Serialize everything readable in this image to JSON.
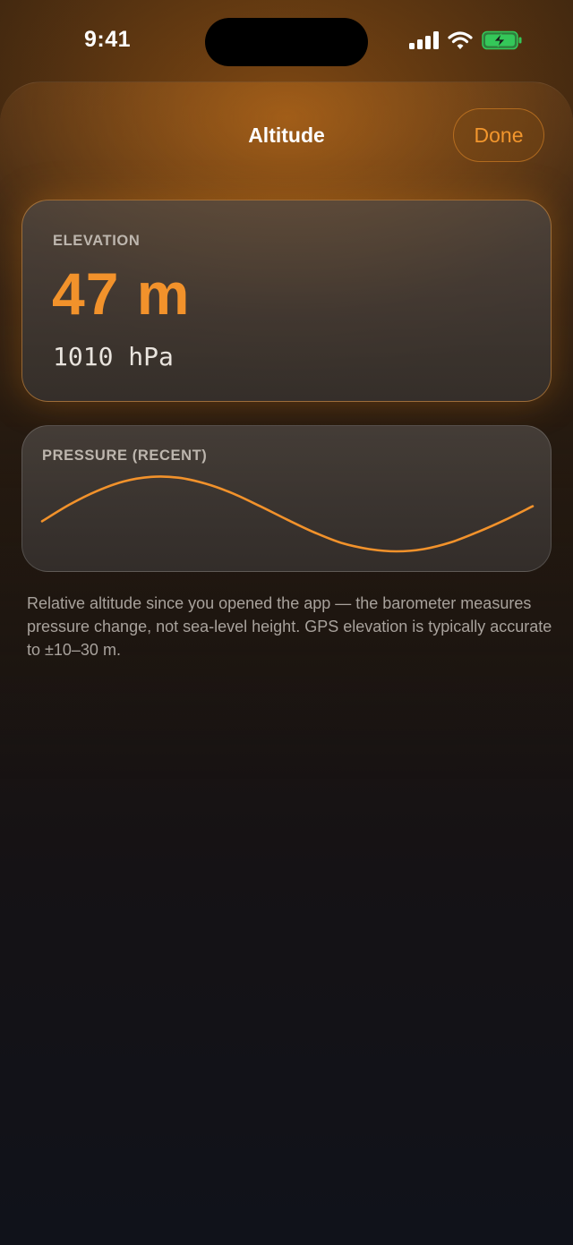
{
  "status_bar": {
    "time": "9:41",
    "icons": [
      "cellular-signal-icon",
      "wifi-icon",
      "battery-charging-icon"
    ]
  },
  "sheet": {
    "title": "Altitude",
    "done_label": "Done"
  },
  "elevation_card": {
    "label": "ELEVATION",
    "value": "47 m",
    "pressure": "1010 hPa"
  },
  "pressure_card": {
    "label": "PRESSURE (RECENT)"
  },
  "chart_data": {
    "type": "line",
    "title": "PRESSURE (RECENT)",
    "series": [
      {
        "values": [
          0.4,
          0.62,
          0.8,
          0.93,
          0.99,
          0.98,
          0.9,
          0.77,
          0.6,
          0.42,
          0.25,
          0.11,
          0.03,
          0.0,
          0.03,
          0.12,
          0.26,
          0.42,
          0.6
        ]
      }
    ],
    "grid": false,
    "legend": "none"
  },
  "footnote": "Relative altitude since you opened the app — the barometer measures pressure change, not sea-level height. GPS elevation is typically accurate to ±10–30 m.",
  "colors": {
    "accent": "#f2922b",
    "background": "#151215",
    "card": "#48423e",
    "text_secondary": "#a8a29c",
    "battery": "#34c759"
  }
}
